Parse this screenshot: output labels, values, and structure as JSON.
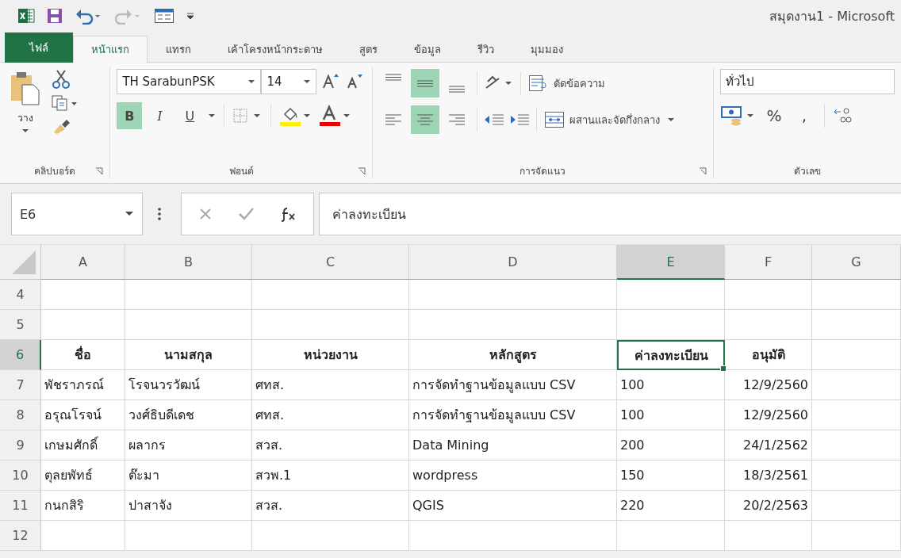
{
  "window": {
    "title": "สมุดงาน1 - Microsoft"
  },
  "tabs": [
    {
      "label": "ไฟล์",
      "kind": "file",
      "selected": false
    },
    {
      "label": "หน้าแรก",
      "kind": "tab",
      "selected": true
    },
    {
      "label": "แทรก",
      "kind": "tab",
      "selected": false
    },
    {
      "label": "เค้าโครงหน้ากระดาษ",
      "kind": "tab",
      "selected": false
    },
    {
      "label": "สูตร",
      "kind": "tab",
      "selected": false
    },
    {
      "label": "ข้อมูล",
      "kind": "tab",
      "selected": false
    },
    {
      "label": "รีวิว",
      "kind": "tab",
      "selected": false
    },
    {
      "label": "มุมมอง",
      "kind": "tab",
      "selected": false
    }
  ],
  "ribbon": {
    "clipboard": {
      "paste_label": "วาง",
      "group_label": "คลิปบอร์ด"
    },
    "font": {
      "font_name": "TH SarabunPSK",
      "font_size": "14",
      "bold_label": "B",
      "italic_label": "I",
      "underline_label": "U",
      "bold": true,
      "italic": false,
      "underline": false,
      "group_label": "ฟอนต์"
    },
    "alignment": {
      "vertical": [
        {
          "selected": false
        },
        {
          "selected": true
        },
        {
          "selected": false
        }
      ],
      "horizontal": [
        {
          "selected": false
        },
        {
          "selected": true
        },
        {
          "selected": false
        }
      ],
      "wrap_text": "ตัดข้อความ",
      "merge": "ผสานและจัดกึ่งกลาง",
      "group_label": "การจัดแนว"
    },
    "number": {
      "format": "ทั่วไป",
      "percent": "%",
      "comma": ",",
      "group_label": "ตัวเลข"
    }
  },
  "formula_bar": {
    "name_box": "E6",
    "formula": "ค่าลงทะเบียน"
  },
  "columns": [
    {
      "label": "A",
      "selected": false
    },
    {
      "label": "B",
      "selected": false
    },
    {
      "label": "C",
      "selected": false
    },
    {
      "label": "D",
      "selected": false
    },
    {
      "label": "E",
      "selected": true
    },
    {
      "label": "F",
      "selected": false
    },
    {
      "label": "G",
      "selected": false
    }
  ],
  "rows": [
    {
      "number": "4",
      "kind": "empty",
      "selected": false,
      "cells": []
    },
    {
      "number": "5",
      "kind": "empty",
      "selected": false,
      "cells": []
    },
    {
      "number": "6",
      "kind": "header",
      "selected": true,
      "cells": [
        "ชื่อ",
        "นามสกุล",
        "หน่วยงาน",
        "หลักสูตร",
        "ค่าลงทะเบียน",
        "อนุมัติ"
      ]
    },
    {
      "number": "7",
      "kind": "data",
      "selected": false,
      "cells": [
        "พัชราภรณ์",
        "โรจนวรวัฒน์",
        "ศทส.",
        "การจัดทำฐานข้อมูลแบบ CSV",
        "100",
        "12/9/2560"
      ]
    },
    {
      "number": "8",
      "kind": "data",
      "selected": false,
      "cells": [
        "อรุณโรจน์",
        "วงศ์ธิบดีเดช",
        "ศทส.",
        "การจัดทำฐานข้อมูลแบบ CSV",
        "100",
        "12/9/2560"
      ]
    },
    {
      "number": "9",
      "kind": "data",
      "selected": false,
      "cells": [
        "เกษมศักดิ์",
        "ผลากร",
        "สวส.",
        "Data Mining",
        "200",
        "24/1/2562"
      ]
    },
    {
      "number": "10",
      "kind": "data",
      "selected": false,
      "cells": [
        "ตุลยพัทธ์",
        "ต๊ะมา",
        "สวพ.1",
        "wordpress",
        "150",
        "18/3/2561"
      ]
    },
    {
      "number": "11",
      "kind": "data",
      "selected": false,
      "cells": [
        "กนกสิริ",
        "ปาสาจัง",
        "สวส.",
        "QGIS",
        "220",
        "20/2/2563"
      ]
    },
    {
      "number": "12",
      "kind": "empty",
      "selected": false,
      "cells": []
    }
  ]
}
